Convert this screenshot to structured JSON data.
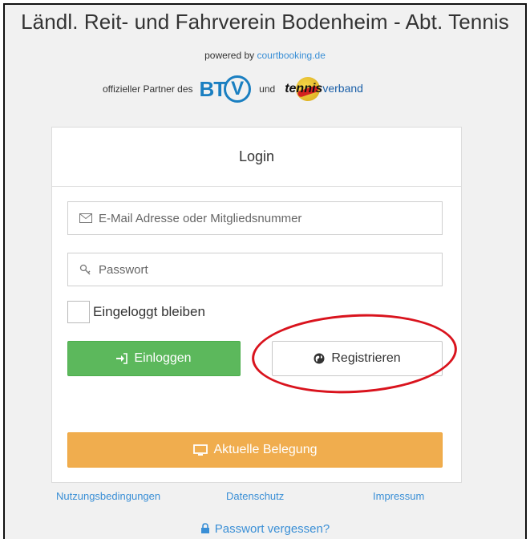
{
  "header": {
    "title": "Ländl. Reit- und Fahrverein Bodenheim - Abt. Tennis",
    "powered_prefix": "powered by",
    "powered_link": "courtbooking.de",
    "partner_prefix": "offizieller Partner des",
    "btv_logo": "BTV",
    "partner_and": "und",
    "tennisverband_logo_bold": "tennis",
    "tennisverband_logo_rest": "verband"
  },
  "login": {
    "heading": "Login",
    "email_placeholder": "E-Mail Adresse oder Mitgliedsnummer",
    "password_placeholder": "Passwort",
    "remember_label": "Eingeloggt bleiben",
    "login_button": "Einloggen",
    "register_button": "Registrieren",
    "belegung_button": "Aktuelle Belegung"
  },
  "footer": {
    "links": [
      "Nutzungsbedingungen",
      "Datenschutz",
      "Impressum"
    ],
    "forgot_password": "Passwort vergessen?"
  },
  "colors": {
    "green": "#5cb85c",
    "orange": "#f0ad4e",
    "link": "#3a8fd6",
    "annotation_circle": "#d9131d"
  },
  "icons": {
    "email": "envelope-icon",
    "password": "key-icon",
    "login": "sign-in-icon",
    "register": "globe-icon",
    "belegung": "monitor-icon",
    "forgot": "lock-icon"
  }
}
